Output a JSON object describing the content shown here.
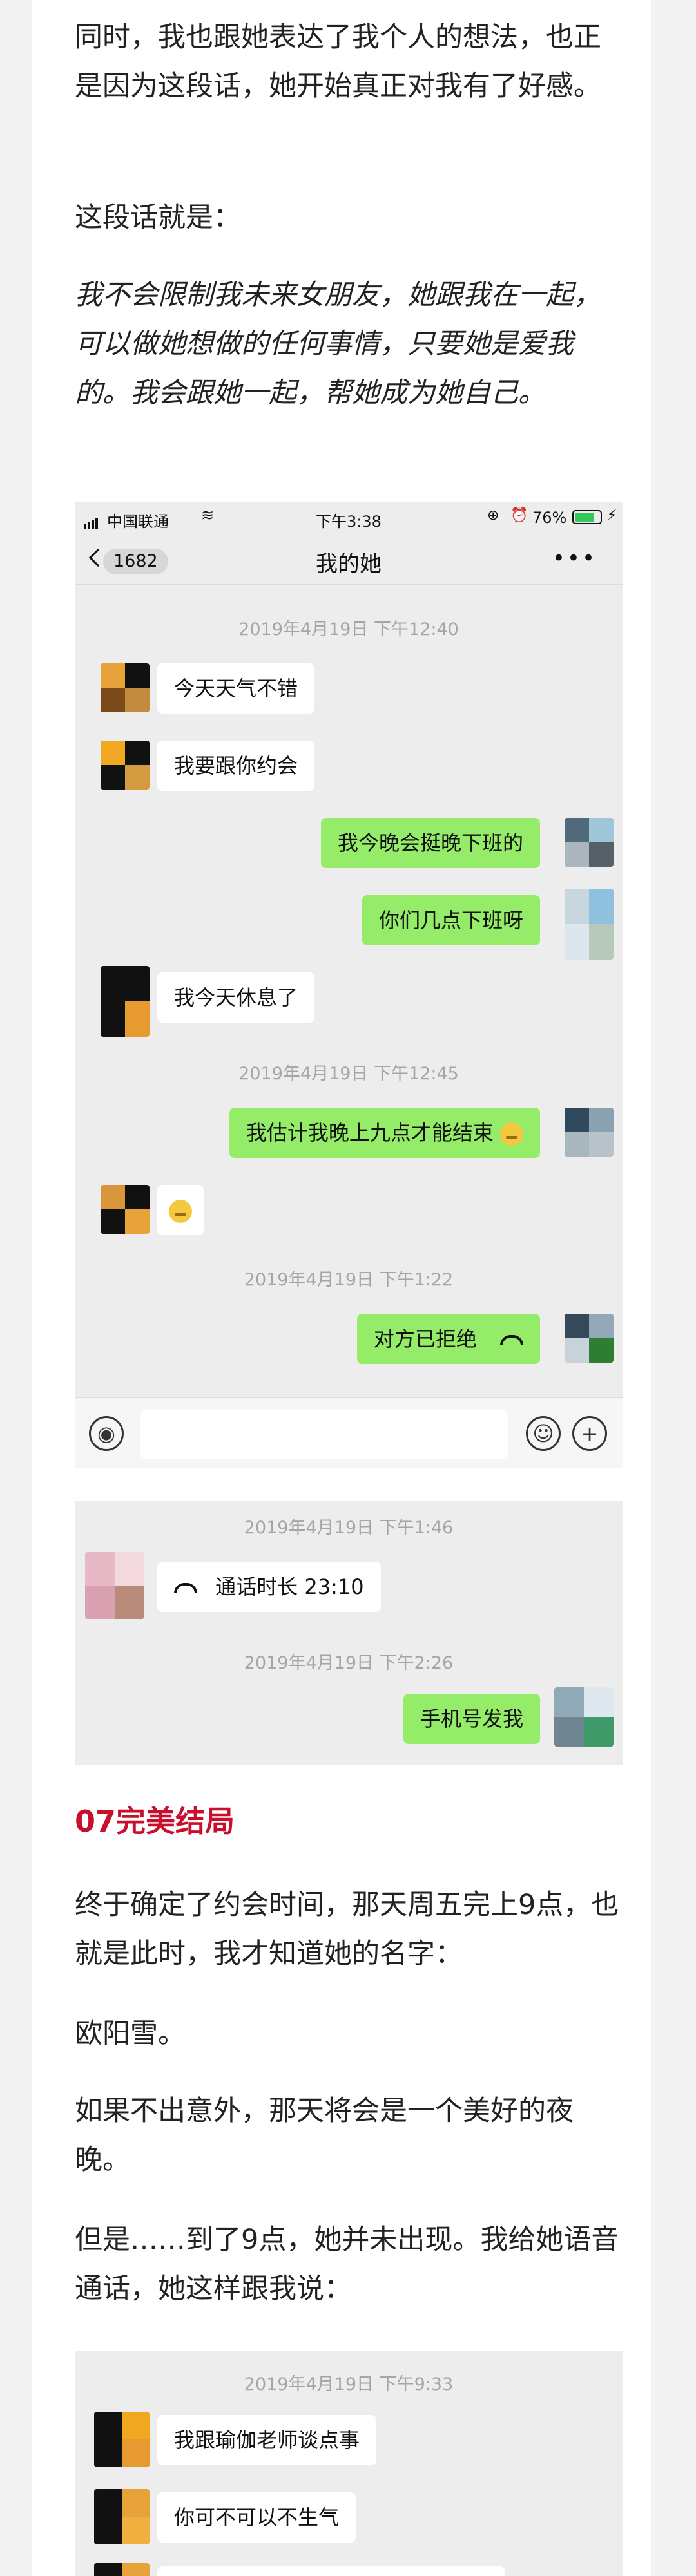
{
  "article": {
    "p1": "同时，我也跟她表达了我个人的想法，也正是因为这段话，她开始真正对我有了好感。",
    "p2": "这段话就是：",
    "quote": "我不会限制我未来女朋友，她跟我在一起，可以做她想做的任何事情，只要她是爱我的。我会跟她一起，帮她成为她自己。",
    "section_heading": "07完美结局",
    "p3": "终于确定了约会时间，那天周五完上9点，也就是此时，我才知道她的名字：",
    "p4": "欧阳雪。",
    "p5": "如果不出意外，那天将会是一个美好的夜晚。",
    "p6": "但是……到了9点，她并未出现。我给她语音通话，她这样跟我说："
  },
  "shot1": {
    "status": {
      "carrier": "中国联通",
      "time": "下午3:38",
      "battery": "76%"
    },
    "nav": {
      "back_count": "1682",
      "title": "我的她",
      "more": "•••"
    },
    "ts1": "2019年4月19日 下午12:40",
    "m1": "今天天气不错",
    "m2": "我要跟你约会",
    "m3": "我今晚会挺晚下班的",
    "m4": "你们几点下班呀",
    "m5": "我今天休息了",
    "ts2": "2019年4月19日 下午12:45",
    "m6": "我估计我晚上九点才能结束",
    "ts3": "2019年4月19日 下午1:22",
    "m8": "对方已拒绝"
  },
  "shot2": {
    "ts1": "2019年4月19日 下午1:46",
    "call": "通话时长 23:10",
    "ts2": "2019年4月19日 下午2:26",
    "m1": "手机号发我"
  },
  "shot3": {
    "ts1": "2019年4月19日 下午9:33",
    "m1": "我跟瑜伽老师谈点事",
    "m2": "你可不可以不生气"
  },
  "colors": {
    "bubble_right": "#95ec69",
    "bubble_left": "#ffffff",
    "chat_bg": "#ededed",
    "heading": "#c8102e"
  }
}
